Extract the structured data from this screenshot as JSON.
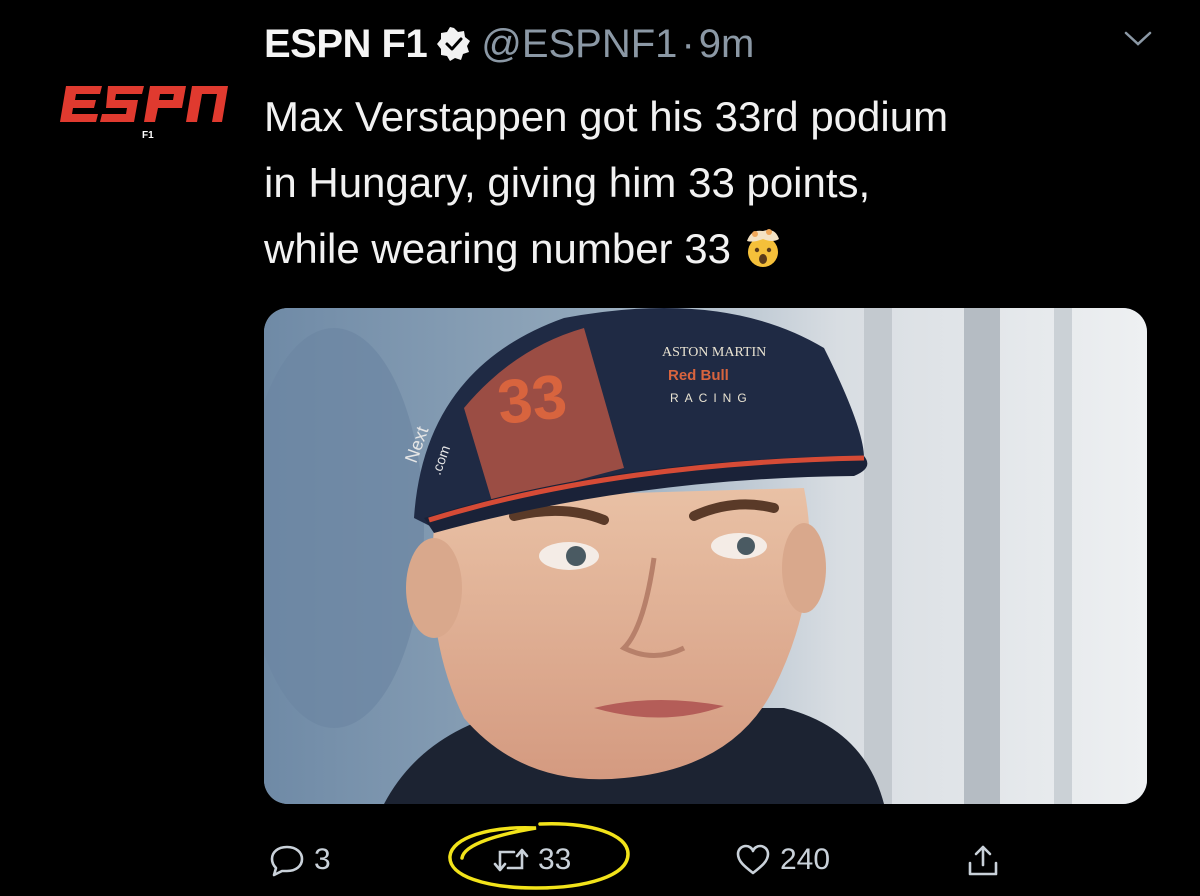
{
  "tweet": {
    "display_name": "ESPN F1",
    "handle": "@ESPNF1",
    "separator": "·",
    "time": "9m",
    "text_lines": [
      "Max Verstappen got his 33rd podium",
      "in Hungary, giving him 33 points,",
      "while wearing number 33"
    ],
    "emoji": "exploding-head-emoji"
  },
  "avatar": {
    "logo_text": "ESPN",
    "sub_text": "F1",
    "logo_color": "#e03a2f"
  },
  "media": {
    "cap_number": "33",
    "cap_brand_line1": "ASTON MARTIN",
    "cap_brand_line2": "Red Bull",
    "cap_brand_line3": "RACING",
    "cap_side_text": "Next",
    "cap_side_text2": ".com"
  },
  "actions": {
    "reply_count": "3",
    "retweet_count": "33",
    "like_count": "240"
  },
  "colors": {
    "background": "#000000",
    "muted": "#8b98a5",
    "annotation": "#f2e31a"
  },
  "icons": {
    "verified": "verified-badge-icon",
    "chevron": "chevron-down-icon",
    "reply": "reply-icon",
    "retweet": "retweet-icon",
    "like": "heart-icon",
    "share": "share-icon"
  }
}
